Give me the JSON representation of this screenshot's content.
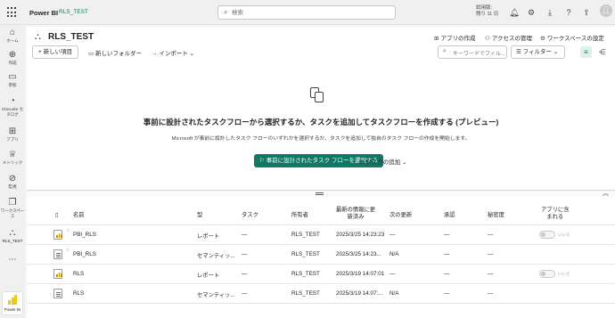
{
  "topbar": {
    "app_name": "Power BI",
    "workspace_crumb": "RLS_TEST",
    "search_placeholder": "検索",
    "trial_line1": "試用版:",
    "trial_line2": "残り 11 日",
    "icons": [
      "bell-icon",
      "gear-icon",
      "download-icon",
      "help-icon",
      "share-icon",
      "avatar"
    ]
  },
  "rail": {
    "items": [
      {
        "label": "ホーム",
        "icon": "home-icon"
      },
      {
        "label": "作成",
        "icon": "plus-icon"
      },
      {
        "label": "参照",
        "icon": "folder-icon"
      },
      {
        "label": "OneLake カタログ",
        "icon": "onelake-icon"
      },
      {
        "label": "アプリ",
        "icon": "apps-icon"
      },
      {
        "label": "メトリック",
        "icon": "trophy-icon"
      },
      {
        "label": "監視",
        "icon": "monitor-icon"
      },
      {
        "label": "ワークスペース",
        "icon": "workspaces-icon"
      },
      {
        "label": "RLS_TEST",
        "icon": "workspace-icon"
      }
    ],
    "more": "⋯",
    "footer_label": "Power BI"
  },
  "header": {
    "title": "RLS_TEST",
    "create_app": "アプリの作成",
    "manage_access": "アクセスの管理",
    "workspace_settings": "ワークスペースの設定"
  },
  "commands": {
    "new_item": "新しい項目",
    "new_folder": "新しいフォルダー",
    "import": "インポート",
    "filter_search_placeholder": "キーワードでフィル...",
    "filter": "フィルター"
  },
  "empty_state": {
    "title": "事前に設計されたタスクフローから選択するか、タスクを追加してタスクフローを作成する (プレビュー)",
    "description": "Microsoft が事前に設計したタスク フローのいずれかを選択するか、タスクを追加して独自のタスク フローの作成を開始します。",
    "primary_button": "事前に設計されたタスク フローを選択する",
    "add_task": "タスクの追加"
  },
  "table": {
    "columns": {
      "name": "名前",
      "type": "型",
      "task": "タスク",
      "owner": "所有者",
      "refreshed_l1": "最新の情報に更",
      "refreshed_l2": "新済み",
      "next_refresh": "次の更新",
      "endorsement": "承認",
      "sensitivity": "秘密度",
      "in_app_l1": "アプリに含",
      "in_app_l2": "まれる"
    },
    "rows": [
      {
        "name": "PBI_RLS",
        "type": "レポート",
        "task": "—",
        "owner": "RLS_TEST",
        "refreshed": "2025/3/25 14:23:23",
        "next_refresh": "—",
        "endorsement": "—",
        "sensitivity": "—",
        "in_app": "いいえ",
        "kind": "report"
      },
      {
        "name": "PBI_RLS",
        "type": "セマンティッ...",
        "task": "—",
        "owner": "RLS_TEST",
        "refreshed": "2025/3/25 14:23...",
        "next_refresh": "N/A",
        "endorsement": "—",
        "sensitivity": "—",
        "in_app": "",
        "kind": "model"
      },
      {
        "name": "RLS",
        "type": "レポート",
        "task": "—",
        "owner": "RLS_TEST",
        "refreshed": "2025/3/19 14:07:01",
        "next_refresh": "—",
        "endorsement": "—",
        "sensitivity": "—",
        "in_app": "いいえ",
        "kind": "report"
      },
      {
        "name": "RLS",
        "type": "セマンティッ...",
        "task": "—",
        "owner": "RLS_TEST",
        "refreshed": "2025/3/19 14:07:...",
        "next_refresh": "N/A",
        "endorsement": "—",
        "sensitivity": "—",
        "in_app": "",
        "kind": "model"
      }
    ]
  },
  "colors": {
    "accent": "#117865",
    "pbi_yellow": "#f2c811"
  }
}
